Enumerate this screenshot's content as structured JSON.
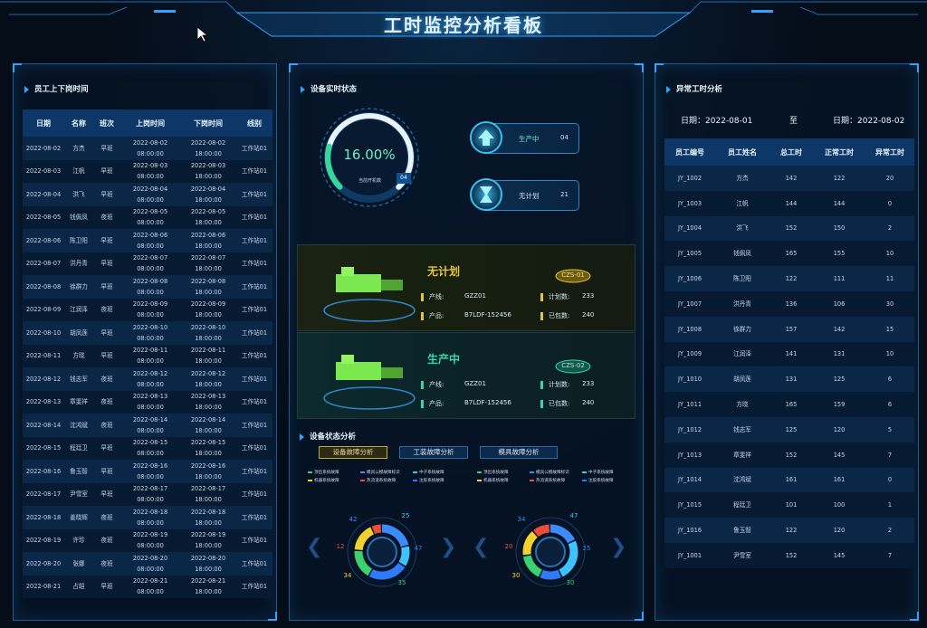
{
  "title": "工时监控分析看板",
  "left_panel": {
    "title": "员工上下岗时间",
    "headers": [
      "日期",
      "名称",
      "班次",
      "上岗时间",
      "下岗时间",
      "线别"
    ],
    "rows": [
      [
        "2022-08-02",
        "方杰",
        "早班",
        "2022-08-02",
        "08:00:00",
        "2022-08-02",
        "18:00:00",
        "工作站01"
      ],
      [
        "2022-08-03",
        "江帆",
        "早班",
        "2022-08-03",
        "08:00:00",
        "2022-08-03",
        "18:00:00",
        "工作站01"
      ],
      [
        "2022-08-04",
        "洪飞",
        "早班",
        "2022-08-04",
        "08:00:00",
        "2022-08-04",
        "18:00:00",
        "工作站01"
      ],
      [
        "2022-08-05",
        "钱佩凤",
        "夜班",
        "2022-08-05",
        "08:00:00",
        "2022-08-05",
        "18:00:00",
        "工作站01"
      ],
      [
        "2022-08-06",
        "陈卫阳",
        "早班",
        "2022-08-06",
        "08:00:00",
        "2022-08-06",
        "18:00:00",
        "工作站01"
      ],
      [
        "2022-08-07",
        "洪丹青",
        "早班",
        "2022-08-07",
        "08:00:00",
        "2022-08-07",
        "18:00:00",
        "工作站01"
      ],
      [
        "2022-08-08",
        "徐群力",
        "早班",
        "2022-08-08",
        "08:00:00",
        "2022-08-08",
        "18:00:00",
        "工作站01"
      ],
      [
        "2022-08-09",
        "江润泽",
        "夜班",
        "2022-08-09",
        "08:00:00",
        "2022-08-09",
        "18:00:00",
        "工作站01"
      ],
      [
        "2022-08-10",
        "胡凤莲",
        "早班",
        "2022-08-10",
        "08:00:00",
        "2022-08-10",
        "18:00:00",
        "工作站01"
      ],
      [
        "2022-08-11",
        "方晓",
        "早班",
        "2022-08-11",
        "08:00:00",
        "2022-08-11",
        "18:00:00",
        "工作站01"
      ],
      [
        "2022-08-12",
        "钱志军",
        "夜班",
        "2022-08-12",
        "08:00:00",
        "2022-08-12",
        "18:00:00",
        "工作站01"
      ],
      [
        "2022-08-13",
        "章斐祥",
        "夜班",
        "2022-08-13",
        "08:00:00",
        "2022-08-13",
        "18:00:00",
        "工作站01"
      ],
      [
        "2022-08-14",
        "沈鸿斌",
        "夜班",
        "2022-08-14",
        "08:00:00",
        "2022-08-14",
        "18:00:00",
        "工作站01"
      ],
      [
        "2022-08-15",
        "程廷卫",
        "早班",
        "2022-08-15",
        "08:00:00",
        "2022-08-15",
        "18:00:00",
        "工作站01"
      ],
      [
        "2022-08-16",
        "鲁玉智",
        "早班",
        "2022-08-16",
        "08:00:00",
        "2022-08-16",
        "18:00:00",
        "工作站01"
      ],
      [
        "2022-08-17",
        "尹雪室",
        "早班",
        "2022-08-17",
        "08:00:00",
        "2022-08-17",
        "18:00:00",
        "工作站01"
      ],
      [
        "2022-08-18",
        "姜晓辉",
        "夜班",
        "2022-08-18",
        "08:00:00",
        "2022-08-18",
        "18:00:00",
        "工作站01"
      ],
      [
        "2022-08-19",
        "许珍",
        "夜班",
        "2022-08-19",
        "08:00:00",
        "2022-08-19",
        "18:00:00",
        "工作站01"
      ],
      [
        "2022-08-20",
        "张娜",
        "夜班",
        "2022-08-20",
        "08:00:00",
        "2022-08-20",
        "18:00:00",
        "工作站01"
      ],
      [
        "2022-08-21",
        "占皑",
        "早班",
        "2022-08-21",
        "08:00:00",
        "2022-08-21",
        "18:00:00",
        "工作站01"
      ]
    ]
  },
  "center": {
    "title": "设备实时状态",
    "gauge": {
      "value": "16.00%",
      "percent": 16,
      "label": "当前开机数",
      "count": "04"
    },
    "status": [
      {
        "label": "生产中",
        "value": "04"
      },
      {
        "label": "无计划",
        "value": "21"
      }
    ],
    "cards": [
      {
        "state": "无计划",
        "code": "CZS-01",
        "line_label": "产线:",
        "line": "GZZ01",
        "product_label": "产品:",
        "product": "B7LDF-152456",
        "plan_label": "计划数:",
        "plan": "233",
        "done_label": "已包数:",
        "done": "240",
        "color": "#e6c53a"
      },
      {
        "state": "生产中",
        "code": "CZS-02",
        "line_label": "产线:",
        "line": "GZZ01",
        "product_label": "产品:",
        "product": "B7LDF-152456",
        "plan_label": "计划数:",
        "plan": "233",
        "done_label": "已包数:",
        "done": "240",
        "color": "#38d3b0"
      }
    ],
    "analysis_title": "设备状态分析",
    "tabs": [
      "设备故障分析",
      "工装故障分析",
      "模具故障分析"
    ],
    "legend": [
      "顶出系统故障",
      "模具公模故障标识",
      "中子系统故障",
      "机器系统故障",
      "热流道系统故障",
      "注胶系统故障"
    ],
    "donuts": [
      {
        "labels": [
          {
            "v": "42",
            "c": "#3d8bff"
          },
          {
            "v": "25",
            "c": "#3dc3ff"
          },
          {
            "v": "47",
            "c": "#2f7bff"
          },
          {
            "v": "35",
            "c": "#3bd16f"
          },
          {
            "v": "34",
            "c": "#f2d12f"
          },
          {
            "v": "12",
            "c": "#ef4b3a"
          }
        ]
      },
      {
        "labels": [
          {
            "v": "34",
            "c": "#3d8bff"
          },
          {
            "v": "47",
            "c": "#3dc3ff"
          },
          {
            "v": "25",
            "c": "#2f7bff"
          },
          {
            "v": "30",
            "c": "#3bd16f"
          },
          {
            "v": "30",
            "c": "#f2d12f"
          },
          {
            "v": "20",
            "c": "#ef4b3a"
          }
        ]
      }
    ]
  },
  "right_panel": {
    "title": "异常工时分析",
    "date_label": "日期：",
    "date_from": "2022-08-01",
    "to": "至",
    "date_to": "2022-08-02",
    "headers": [
      "员工编号",
      "员工姓名",
      "总工时",
      "正常工时",
      "异常工时"
    ],
    "rows": [
      [
        "JY_1002",
        "方杰",
        "142",
        "122",
        "20"
      ],
      [
        "JY_1003",
        "江帆",
        "144",
        "144",
        "0"
      ],
      [
        "JY_1004",
        "洪飞",
        "152",
        "150",
        "2"
      ],
      [
        "JY_1005",
        "钱佩凤",
        "165",
        "155",
        "10"
      ],
      [
        "JY_1006",
        "陈卫阳",
        "122",
        "111",
        "11"
      ],
      [
        "JY_1007",
        "洪丹青",
        "136",
        "106",
        "30"
      ],
      [
        "JY_1008",
        "徐群力",
        "157",
        "142",
        "15"
      ],
      [
        "JY_1009",
        "江润泽",
        "141",
        "131",
        "10"
      ],
      [
        "JY_1010",
        "胡凤莲",
        "131",
        "125",
        "6"
      ],
      [
        "JY_1011",
        "方晓",
        "165",
        "159",
        "6"
      ],
      [
        "JY_1012",
        "钱志军",
        "125",
        "120",
        "5"
      ],
      [
        "JY_1013",
        "章斐祥",
        "152",
        "145",
        "7"
      ],
      [
        "JY_1014",
        "沈鸿斌",
        "161",
        "161",
        "0"
      ],
      [
        "JY_1015",
        "程廷卫",
        "101",
        "100",
        "1"
      ],
      [
        "JY_1016",
        "鲁玉智",
        "122",
        "120",
        "2"
      ],
      [
        "JY_1001",
        "尹雪室",
        "152",
        "145",
        "7"
      ]
    ]
  },
  "colors": {
    "accent": "#2ea5ff",
    "header_bg": "#0c3766",
    "warn": "#e6c53a",
    "ok": "#38d3b0"
  }
}
